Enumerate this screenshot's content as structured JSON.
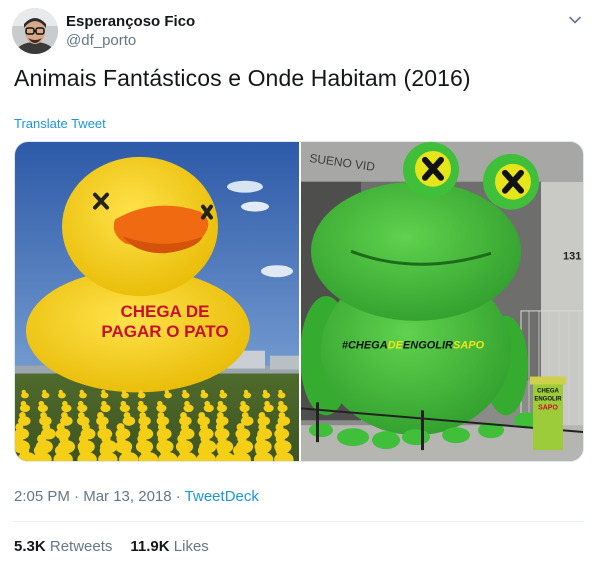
{
  "author": {
    "name": "Esperançoso Fico",
    "handle": "@df_porto"
  },
  "tweet": {
    "text": "Animais Fantásticos e Onde Habitam (2016)",
    "translate_label": "Translate Tweet"
  },
  "media": {
    "left_photo": {
      "sign_line1": "CHEGA DE",
      "sign_line2": "PAGAR O PATO"
    },
    "right_photo": {
      "building_text": "SUENO VID",
      "building_number": "131",
      "banner_part1": "#CHEGA",
      "banner_part2": "DE",
      "banner_part3": "ENGOLIR",
      "banner_part4": "SAPO",
      "sign_line1": "CHEGA",
      "sign_line2": "ENGOLIR",
      "sign_line3": "SAPO"
    }
  },
  "meta": {
    "time": "2:05 PM",
    "separator": " · ",
    "date": "Mar 13, 2018",
    "source": "TweetDeck"
  },
  "stats": {
    "retweets_count": "5.3K",
    "retweets_label": "Retweets",
    "likes_count": "11.9K",
    "likes_label": "Likes"
  },
  "colors": {
    "link": "#1b95e0",
    "secondary_text": "#657786",
    "primary_text": "#14171a",
    "duck_yellow": "#f7d21c",
    "frog_green": "#3fbf3a"
  }
}
